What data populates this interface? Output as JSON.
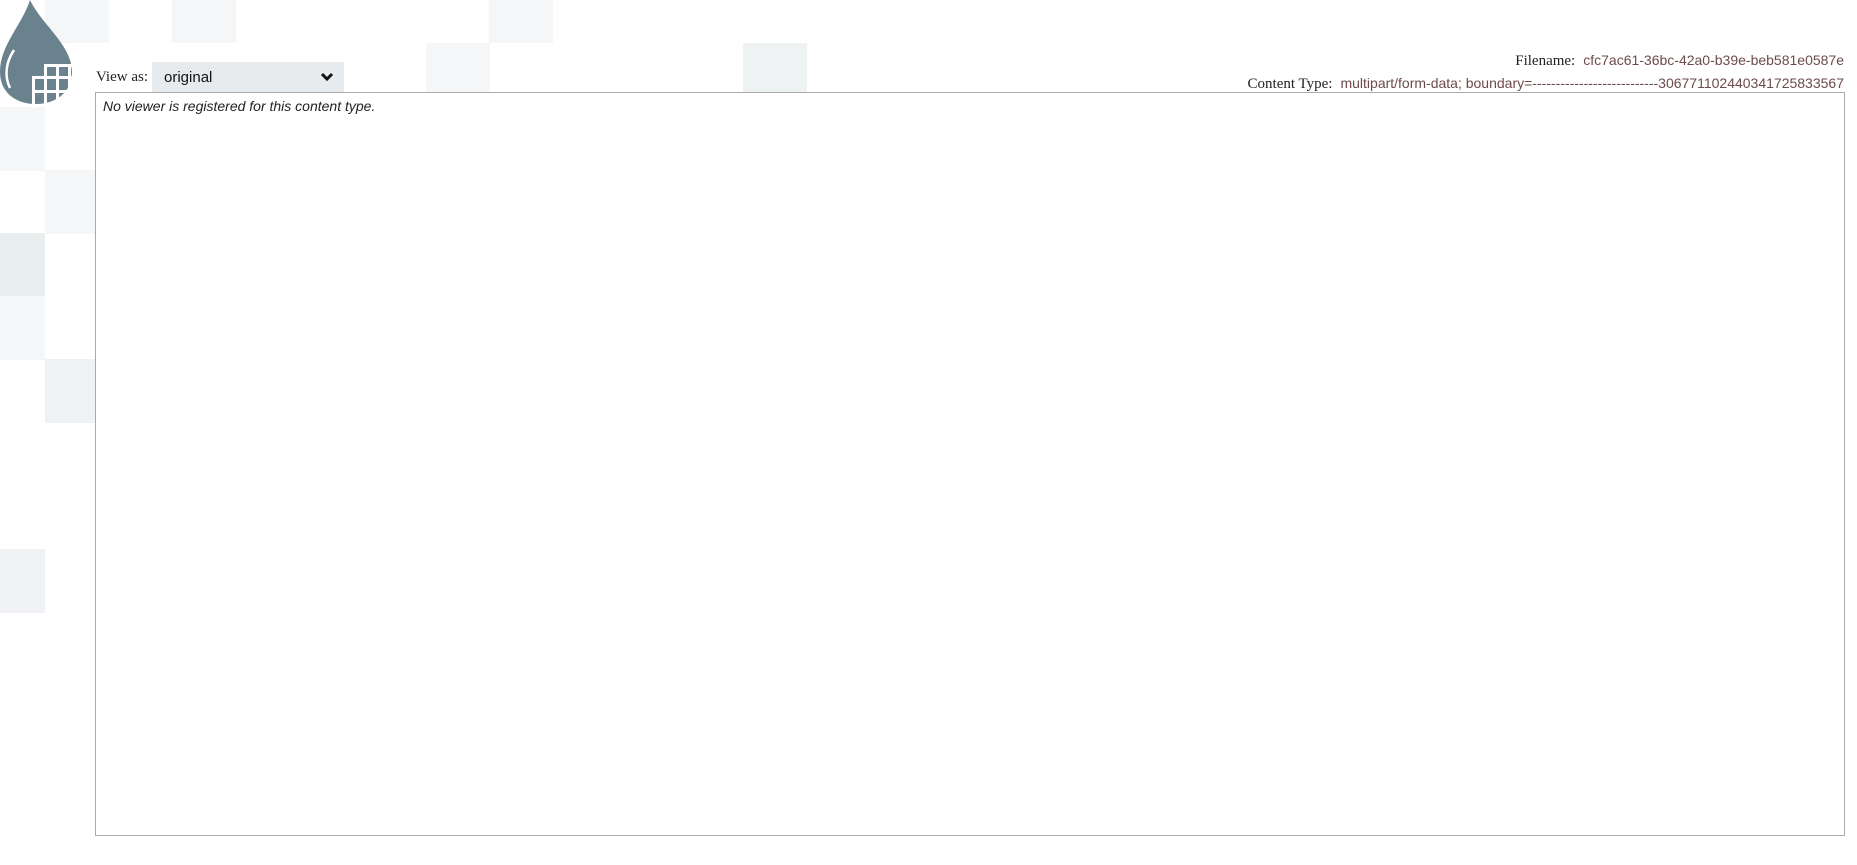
{
  "view_as": {
    "label": "View as:",
    "selected": "original"
  },
  "meta": {
    "filename_label": "Filename:",
    "filename": "cfc7ac61-36bc-42a0-b39e-beb581e0587e",
    "content_type_label": "Content Type:",
    "content_type": "multipart/form-data; boundary=---------------------------306771102440341725833567"
  },
  "viewer": {
    "message": "No viewer is registered for this content type."
  },
  "colors": {
    "logo": "#6a828e",
    "value_text": "#6e4b4b",
    "select_bg": "#e8ebee"
  }
}
